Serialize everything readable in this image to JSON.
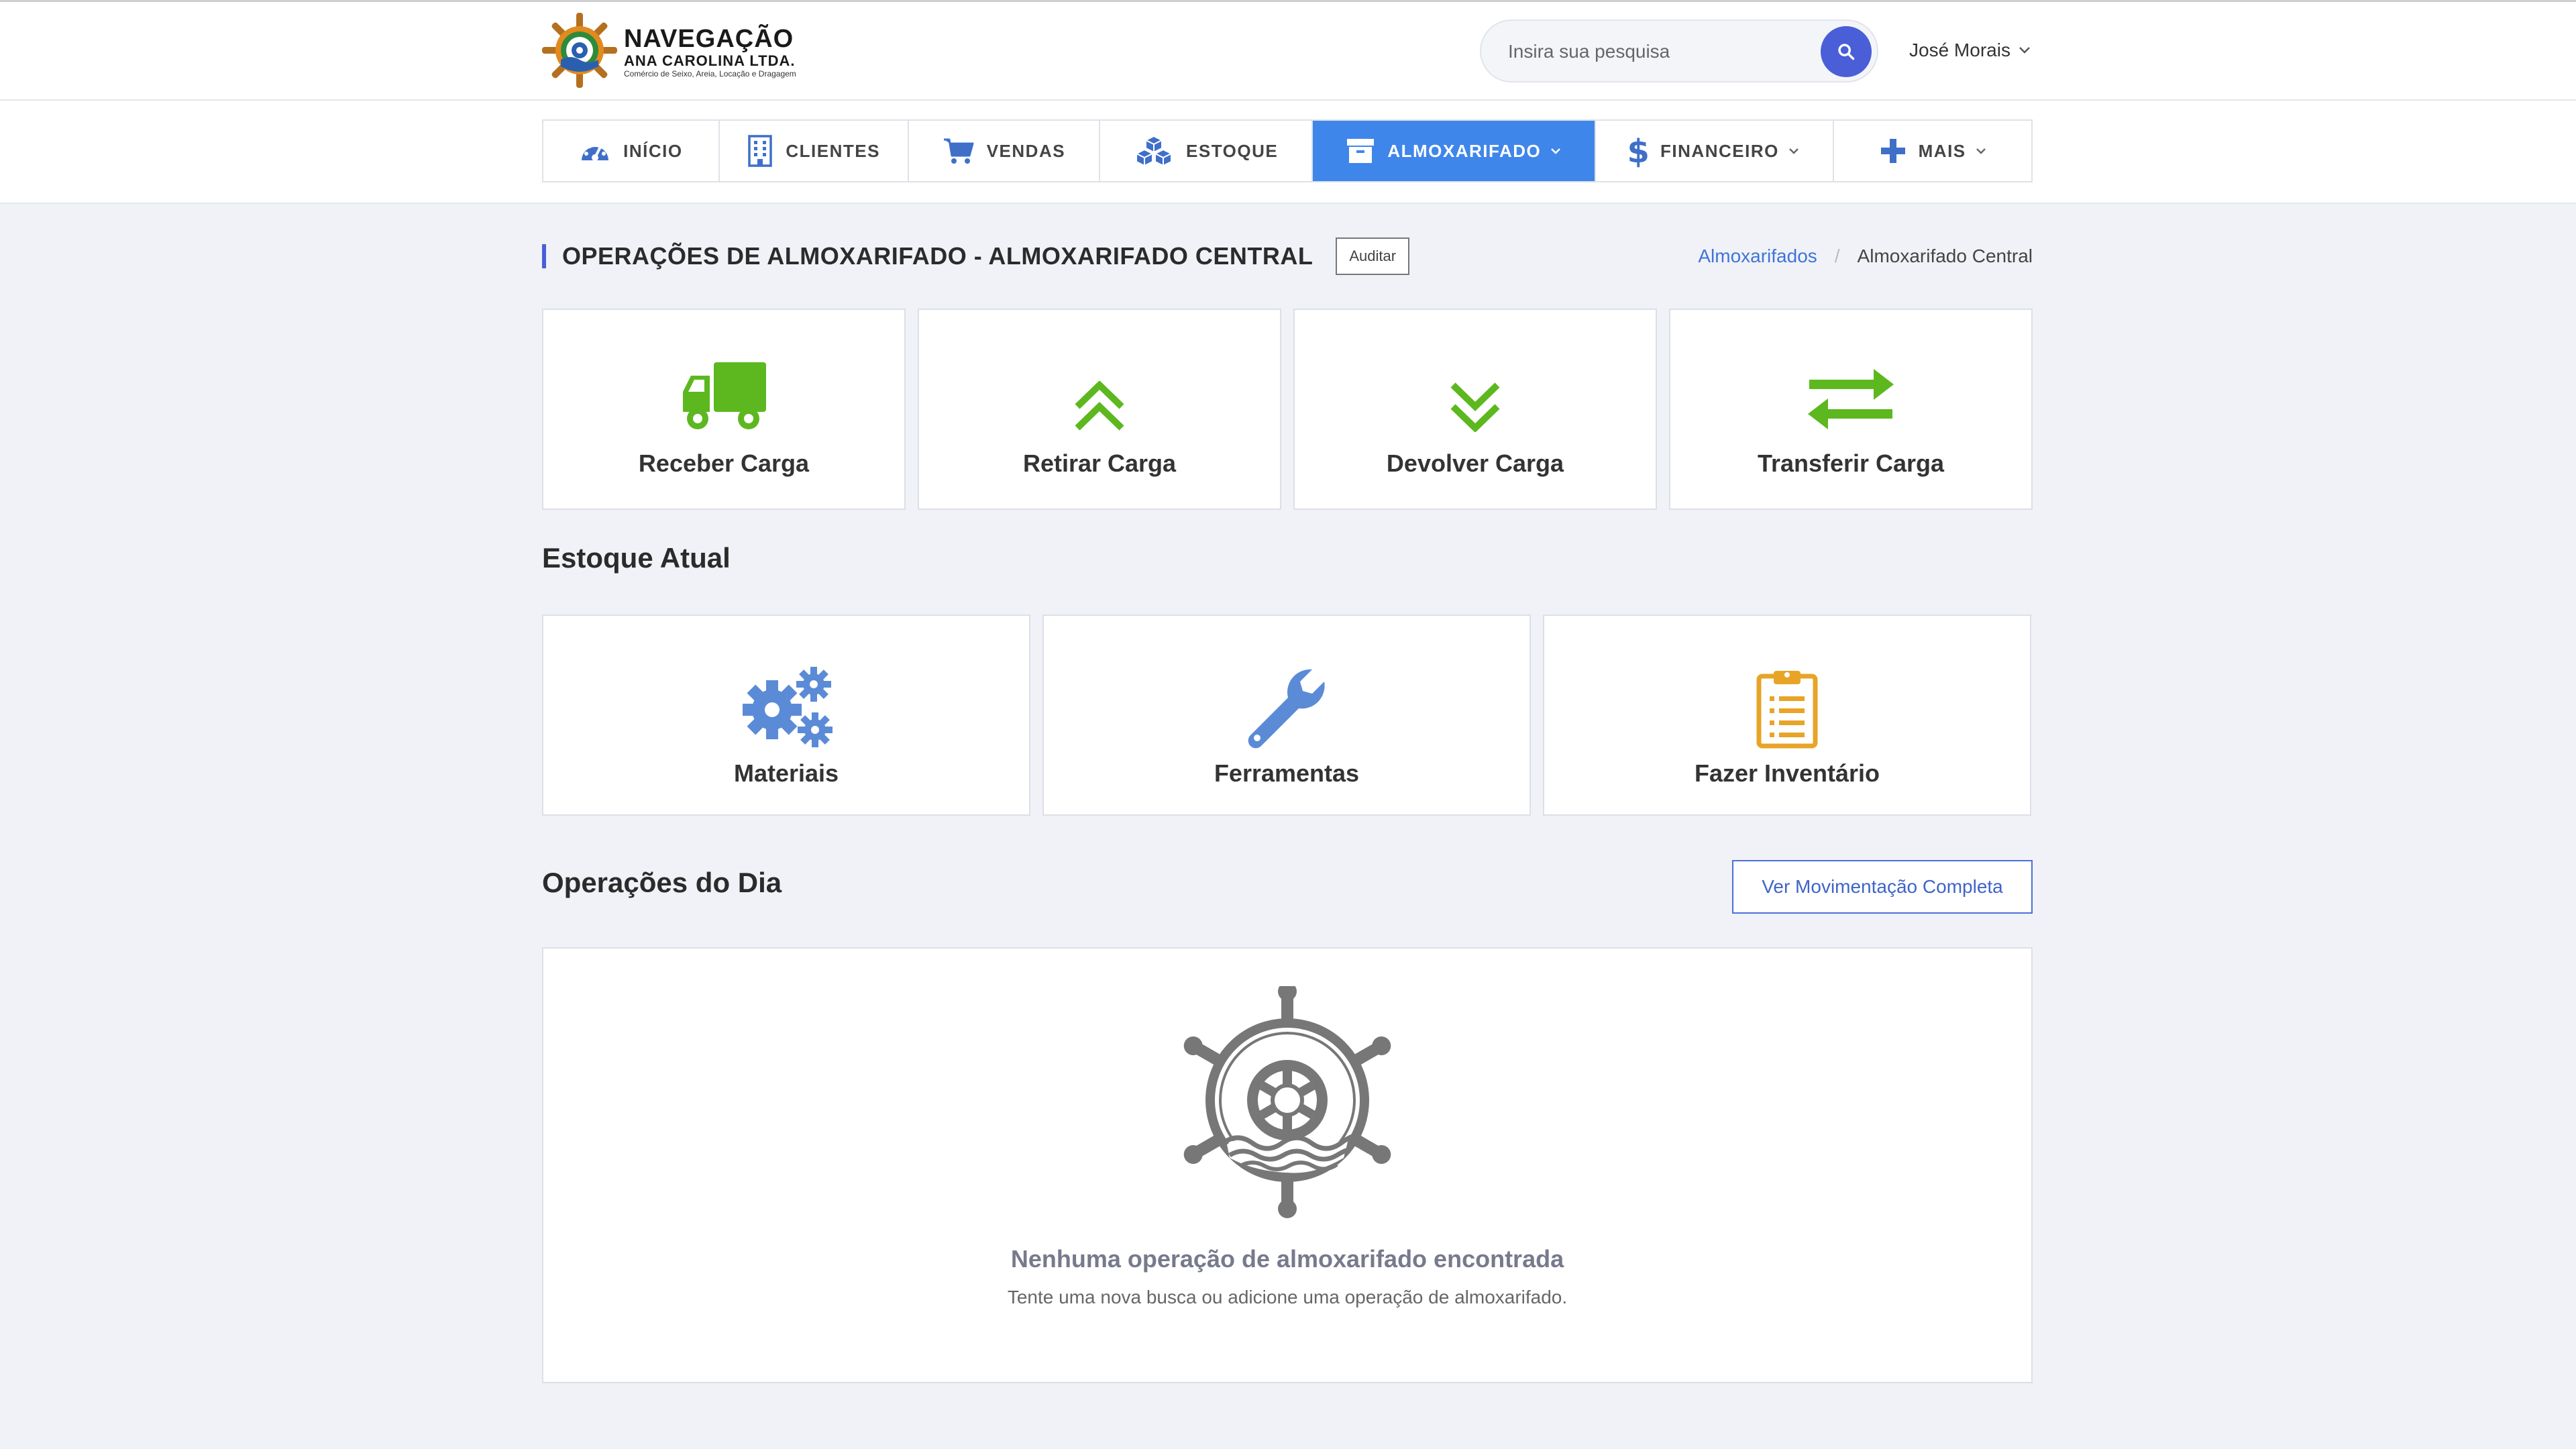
{
  "header": {
    "logo": {
      "line1": "NAVEGAÇÃO",
      "line2": "ANA CAROLINA LTDA.",
      "line3": "Comércio de Seixo, Areia, Locação e Dragagem"
    },
    "search": {
      "placeholder": "Insira sua pesquisa",
      "value": ""
    },
    "user": {
      "name": "José Morais"
    }
  },
  "nav": {
    "items": [
      {
        "label": "INÍCIO",
        "icon": "dashboard-icon"
      },
      {
        "label": "CLIENTES",
        "icon": "building-icon"
      },
      {
        "label": "VENDAS",
        "icon": "cart-icon"
      },
      {
        "label": "ESTOQUE",
        "icon": "cubes-icon"
      },
      {
        "label": "ALMOXARIFADO",
        "icon": "archive-icon",
        "active": true,
        "dropdown": true
      },
      {
        "label": "FINANCEIRO",
        "icon": "dollar-icon",
        "dropdown": true
      },
      {
        "label": "MAIS",
        "icon": "plus-icon",
        "dropdown": true
      }
    ]
  },
  "page": {
    "title": "OPERAÇÕES DE ALMOXARIFADO - ALMOXARIFADO CENTRAL",
    "audit_label": "Auditar",
    "breadcrumb": {
      "parent": "Almoxarifados",
      "current": "Almoxarifado Central"
    }
  },
  "operations": [
    {
      "label": "Receber Carga",
      "icon": "truck-icon"
    },
    {
      "label": "Retirar Carga",
      "icon": "double-chevron-up-icon"
    },
    {
      "label": "Devolver Carga",
      "icon": "double-chevron-down-icon"
    },
    {
      "label": "Transferir Carga",
      "icon": "exchange-icon"
    }
  ],
  "stock": {
    "title": "Estoque Atual",
    "items": [
      {
        "label": "Materiais",
        "icon": "gears-icon"
      },
      {
        "label": "Ferramentas",
        "icon": "wrench-icon"
      },
      {
        "label": "Fazer Inventário",
        "icon": "clipboard-icon"
      }
    ]
  },
  "day_ops": {
    "title": "Operações do Dia",
    "full_button": "Ver Movimentação Completa",
    "empty_title": "Nenhuma operação de almoxarifado encontrada",
    "empty_subtitle": "Tente uma nova busca ou adicione uma operação de almoxarifado."
  },
  "colors": {
    "primary": "#4a5ed8",
    "nav_active": "#3f86ea",
    "green": "#5cb81e",
    "icon_blue": "#5b8bd6",
    "orange": "#e7a427",
    "gray_icon": "#777777"
  }
}
